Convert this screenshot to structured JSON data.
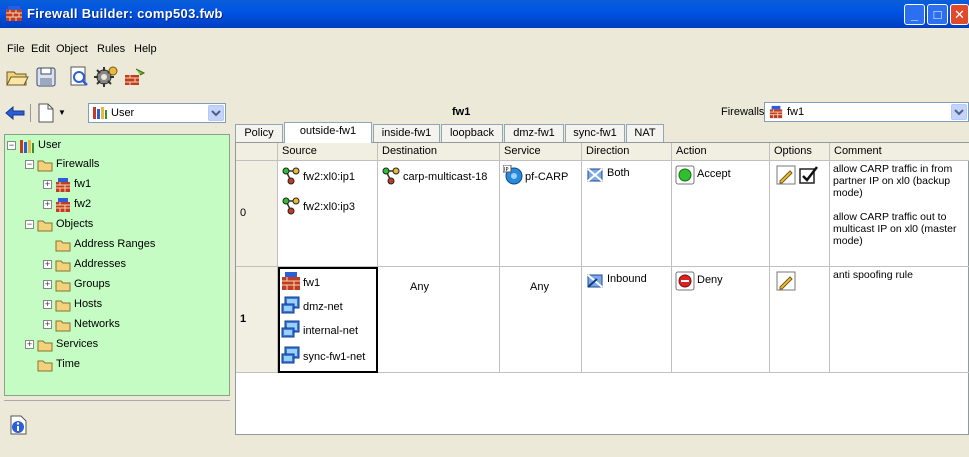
{
  "window": {
    "title": "Firewall Builder: comp503.fwb"
  },
  "menu": [
    "File",
    "Edit",
    "Object",
    "Rules",
    "Help"
  ],
  "toolbar": {
    "icons": [
      "open-folder-icon",
      "save-icon",
      "find-icon",
      "compile-icon",
      "install-icon"
    ]
  },
  "library": {
    "selected": "User"
  },
  "tree": {
    "nodes": [
      {
        "label": "User"
      },
      {
        "label": "Firewalls"
      },
      {
        "label": "fw1"
      },
      {
        "label": "fw2"
      },
      {
        "label": "Objects"
      },
      {
        "label": "Address Ranges"
      },
      {
        "label": "Addresses"
      },
      {
        "label": "Groups"
      },
      {
        "label": "Hosts"
      },
      {
        "label": "Networks"
      },
      {
        "label": "Services"
      },
      {
        "label": "Time"
      }
    ]
  },
  "header": {
    "firewall_name": "fw1",
    "firewalls_label": "Firewalls:",
    "firewalls_selected": "fw1"
  },
  "tabs": [
    "Policy",
    "outside-fw1",
    "inside-fw1",
    "loopback",
    "dmz-fw1",
    "sync-fw1",
    "NAT"
  ],
  "active_tab": "outside-fw1",
  "columns": [
    "Source",
    "Destination",
    "Service",
    "Direction",
    "Action",
    "Options",
    "Comment"
  ],
  "rules": [
    {
      "num": "0",
      "source": [
        "fw2:xl0:ip1",
        "fw2:xl0:ip3"
      ],
      "destination": [
        "carp-multicast-18"
      ],
      "service": [
        "pf-CARP"
      ],
      "direction": "Both",
      "action": "Accept",
      "comment": "allow CARP traffic in from partner IP on xl0 (backup mode)\n\nallow CARP traffic out to multicast IP on xl0 (master mode)"
    },
    {
      "num": "1",
      "source": [
        "fw1",
        "dmz-net",
        "internal-net",
        "sync-fw1-net"
      ],
      "destination": "Any",
      "service": "Any",
      "direction": "Inbound",
      "action": "Deny",
      "comment": "anti spoofing rule"
    }
  ],
  "colors": {
    "tree_bg": "#c4fcc4",
    "titlebar": "#0054e3",
    "accept": "#2fbf2f",
    "deny": "#e02020"
  }
}
